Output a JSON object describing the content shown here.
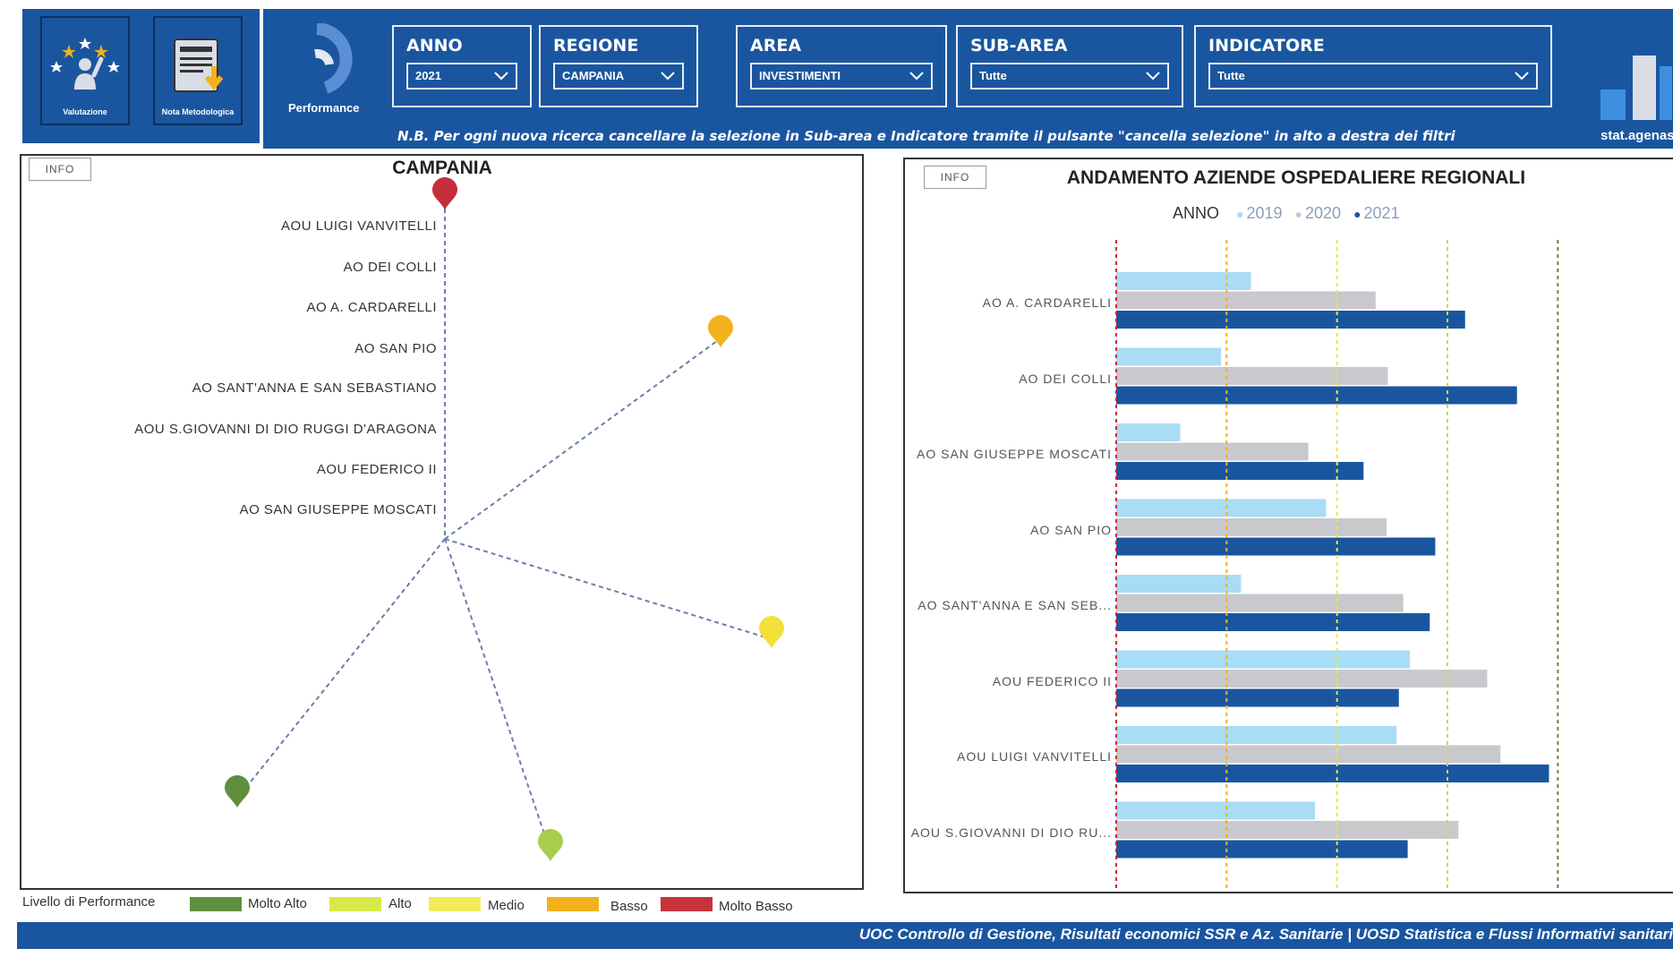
{
  "header": {
    "tiles": [
      {
        "caption": "Valutazione",
        "icon": "stars-person-icon"
      },
      {
        "caption": "Nota Metodologica",
        "icon": "document-download-icon"
      }
    ],
    "performance_label": "Performance",
    "filters": [
      {
        "label": "ANNO",
        "value": "2021"
      },
      {
        "label": "REGIONE",
        "value": "CAMPANIA"
      },
      {
        "label": "AREA",
        "value": "INVESTIMENTI"
      },
      {
        "label": "SUB-AREA",
        "value": "Tutte"
      },
      {
        "label": "INDICATORE",
        "value": "Tutte"
      }
    ],
    "note": "N.B. Per ogni nuova ricerca cancellare la selezione in Sub-area e Indicatore tramite il pulsante \"cancella selezione\" in alto a destra dei filtri",
    "logo_label": "stat.agenas"
  },
  "left_panel": {
    "info_label": "INFO",
    "title": "CAMPANIA",
    "organizations": [
      "AOU LUIGI VANVITELLI",
      "AO DEI COLLI",
      "AO A. CARDARELLI",
      "AO SAN PIO",
      "AO SANT'ANNA E SAN SEBASTIANO",
      "AOU S.GIOVANNI DI DIO RUGGI D'ARAGONA",
      "AOU FEDERICO II",
      "AO SAN GIUSEPPE MOSCATI"
    ],
    "pins": [
      {
        "level": "Molto Basso",
        "color": "#c62d3a"
      },
      {
        "level": "Basso",
        "color": "#f3b21b"
      },
      {
        "level": "Medio",
        "color": "#f4e03a"
      },
      {
        "level": "Molto Alto",
        "color": "#5f8f3c"
      },
      {
        "level": "Alto",
        "color": "#a6cd4e"
      }
    ],
    "legend": {
      "title": "Livello di Performance",
      "items": [
        {
          "label": "Molto Alto",
          "color": "#5f8f3c"
        },
        {
          "label": "Alto",
          "color": "#d8e84a"
        },
        {
          "label": "Medio",
          "color": "#f3ea5c"
        },
        {
          "label": "Basso",
          "color": "#f3b21b"
        },
        {
          "label": "Molto Basso",
          "color": "#c8323a"
        }
      ]
    }
  },
  "right_panel": {
    "info_label": "INFO",
    "title": "ANDAMENTO AZIENDE OSPEDALIERE REGIONALI",
    "legend_title": "ANNO",
    "chart_data": {
      "type": "bar",
      "orientation": "horizontal",
      "title": "ANDAMENTO AZIENDE OSPEDALIERE REGIONALI",
      "categories": [
        "AO A. CARDARELLI",
        "AO DEI COLLI",
        "AO SAN GIUSEPPE MOSCATI",
        "AO SAN PIO",
        "AO SANT'ANNA E SAN SEB...",
        "AOU FEDERICO II",
        "AOU LUIGI VANVITELLI",
        "AOU S.GIOVANNI DI DIO RU..."
      ],
      "series": [
        {
          "name": "2019",
          "color": "#a9dcf5",
          "values": [
            1.22,
            0.95,
            0.58,
            1.9,
            1.13,
            2.66,
            2.54,
            1.8
          ]
        },
        {
          "name": "2020",
          "color": "#c9c9cd",
          "values": [
            2.35,
            2.46,
            1.74,
            2.45,
            2.6,
            3.36,
            3.48,
            3.1
          ]
        },
        {
          "name": "2021",
          "color": "#1a56a0",
          "values": [
            3.16,
            3.63,
            2.24,
            2.89,
            2.84,
            2.56,
            3.92,
            2.64
          ]
        }
      ],
      "reference_lines": [
        {
          "value": 0,
          "color": "#d0233a"
        },
        {
          "value": 1,
          "color": "#f3b21b"
        },
        {
          "value": 2,
          "color": "#ece34a"
        },
        {
          "value": 3,
          "color": "#c9d94a"
        },
        {
          "value": 4,
          "color": "#5f8f3c"
        }
      ],
      "xlim": [
        0,
        4.2
      ],
      "legend_position": "top"
    }
  },
  "footer": {
    "text": "UOC Controllo di Gestione, Risultati economici SSR  e Az. Sanitarie  |  UOSD Statistica e Flussi Informativi sanitari"
  }
}
